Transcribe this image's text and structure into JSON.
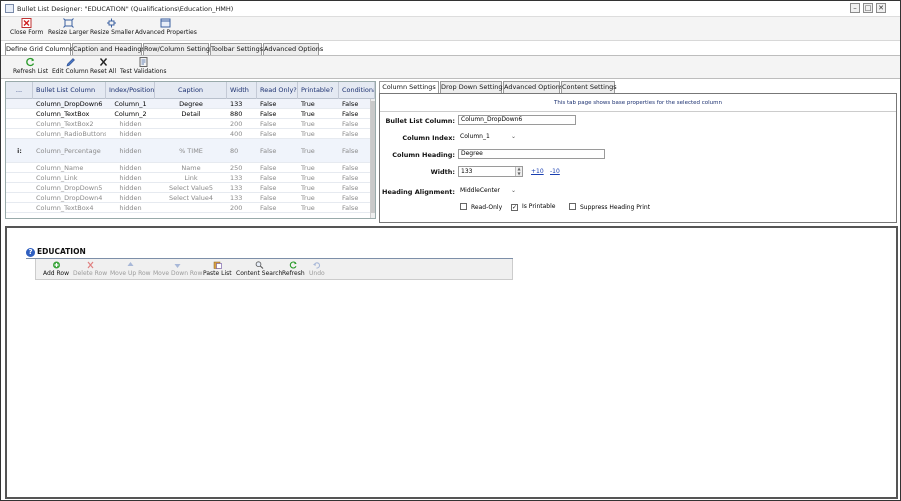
{
  "window": {
    "title": "Bullet List Designer: \"EDUCATION\" (Qualifications\\Education_HMH)",
    "controls": [
      "–",
      "□",
      "✕"
    ]
  },
  "main_toolbar": [
    {
      "label": "Close Form",
      "icon": "close-form-icon"
    },
    {
      "label": "Resize Larger",
      "icon": "resize-larger-icon"
    },
    {
      "label": "Resize Smaller",
      "icon": "resize-smaller-icon"
    },
    {
      "label": "Advanced Properties",
      "icon": "advanced-properties-icon"
    }
  ],
  "main_tabs": [
    "Define Grid Columns",
    "Caption and Headings",
    "Row/Column Settings",
    "Toolbar Settings",
    "Advanced Options"
  ],
  "sub_toolbar": [
    {
      "label": "Refresh List",
      "icon": "refresh-icon"
    },
    {
      "label": "Edit Column",
      "icon": "pencil-icon"
    },
    {
      "label": "Reset All",
      "icon": "x-icon"
    },
    {
      "label": "Test Validations",
      "icon": "test-icon"
    }
  ],
  "grid": {
    "headers": [
      "...",
      "Bullet List Column",
      "Index/Position",
      "Caption",
      "Width",
      "Read Only?",
      "Printable?",
      "Conditional?"
    ],
    "rows": [
      {
        "marker": "",
        "column": "Column_DropDown6",
        "index": "Column_1",
        "caption": "Degree",
        "width": "133",
        "read_only": "False",
        "printable": "True",
        "conditional": "False",
        "state": "active"
      },
      {
        "marker": "",
        "column": "Column_TextBox",
        "index": "Column_2",
        "caption": "Detail",
        "width": "880",
        "read_only": "False",
        "printable": "True",
        "conditional": "False",
        "state": "active"
      },
      {
        "marker": "",
        "column": "Column_TextBox2",
        "index": "hidden",
        "caption": "",
        "width": "200",
        "read_only": "False",
        "printable": "True",
        "conditional": "False",
        "state": "inactive"
      },
      {
        "marker": "",
        "column": "Column_RadioButtons",
        "index": "hidden",
        "caption": "",
        "width": "400",
        "read_only": "False",
        "printable": "True",
        "conditional": "False",
        "state": "inactive"
      },
      {
        "marker": "i:",
        "column": "Column_Percentage",
        "index": "hidden",
        "caption": "% TIME",
        "width": "80",
        "read_only": "False",
        "printable": "True",
        "conditional": "False",
        "state": "inactive"
      },
      {
        "marker": "",
        "column": "Column_Name",
        "index": "hidden",
        "caption": "Name",
        "width": "250",
        "read_only": "False",
        "printable": "True",
        "conditional": "False",
        "state": "inactive"
      },
      {
        "marker": "",
        "column": "Column_Link",
        "index": "hidden",
        "caption": "Link",
        "width": "133",
        "read_only": "False",
        "printable": "True",
        "conditional": "False",
        "state": "inactive"
      },
      {
        "marker": "",
        "column": "Column_DropDown5",
        "index": "hidden",
        "caption": "Select Value5",
        "width": "133",
        "read_only": "False",
        "printable": "True",
        "conditional": "False",
        "state": "inactive"
      },
      {
        "marker": "",
        "column": "Column_DropDown4",
        "index": "hidden",
        "caption": "Select Value4",
        "width": "133",
        "read_only": "False",
        "printable": "True",
        "conditional": "False",
        "state": "inactive"
      },
      {
        "marker": "",
        "column": "Column_TextBox4",
        "index": "hidden",
        "caption": "",
        "width": "200",
        "read_only": "False",
        "printable": "True",
        "conditional": "False",
        "state": "inactive"
      }
    ]
  },
  "right_tabs": [
    "Column Settings",
    "Drop Down Settings",
    "Advanced Options",
    "Content Settings"
  ],
  "column_settings": {
    "notice": "This tab page shows base properties for the selected column",
    "bullet_list_column_label": "Bullet List Column:",
    "bullet_list_column_value": "Column_DropDown6",
    "column_index_label": "Column Index:",
    "column_index_value": "Column_1",
    "column_heading_label": "Column Heading:",
    "column_heading_value": "Degree",
    "width_label": "Width:",
    "width_value": "133",
    "plus_link": "+10",
    "minus_link": "-10",
    "heading_alignment_label": "Heading Alignment:",
    "heading_alignment_value": "MiddleCenter",
    "read_only_label": "Read-Only",
    "read_only_checked": false,
    "is_printable_label": "Is Printable",
    "is_printable_checked": true,
    "suppress_heading_label": "Suppress Heading Print",
    "suppress_heading_checked": false
  },
  "preview": {
    "help_icon": "?",
    "title": "EDUCATION",
    "toolbar": [
      {
        "label": "Add Row",
        "icon": "add-icon",
        "enabled": true
      },
      {
        "label": "Delete Row",
        "icon": "delete-icon",
        "enabled": false
      },
      {
        "label": "Move Up Row",
        "icon": "up-icon",
        "enabled": false
      },
      {
        "label": "Move Down Row",
        "icon": "down-icon",
        "enabled": false
      },
      {
        "label": "Paste List",
        "icon": "paste-icon",
        "enabled": true
      },
      {
        "label": "Content Search",
        "icon": "search-icon",
        "enabled": true
      },
      {
        "label": "Refresh",
        "icon": "refresh-icon",
        "enabled": true
      },
      {
        "label": "Undo",
        "icon": "undo-icon",
        "enabled": false
      }
    ]
  },
  "colors": {
    "header_text": "#1a2f6f",
    "link": "#1a3fb0",
    "help_icon": "#2f5fc0"
  }
}
